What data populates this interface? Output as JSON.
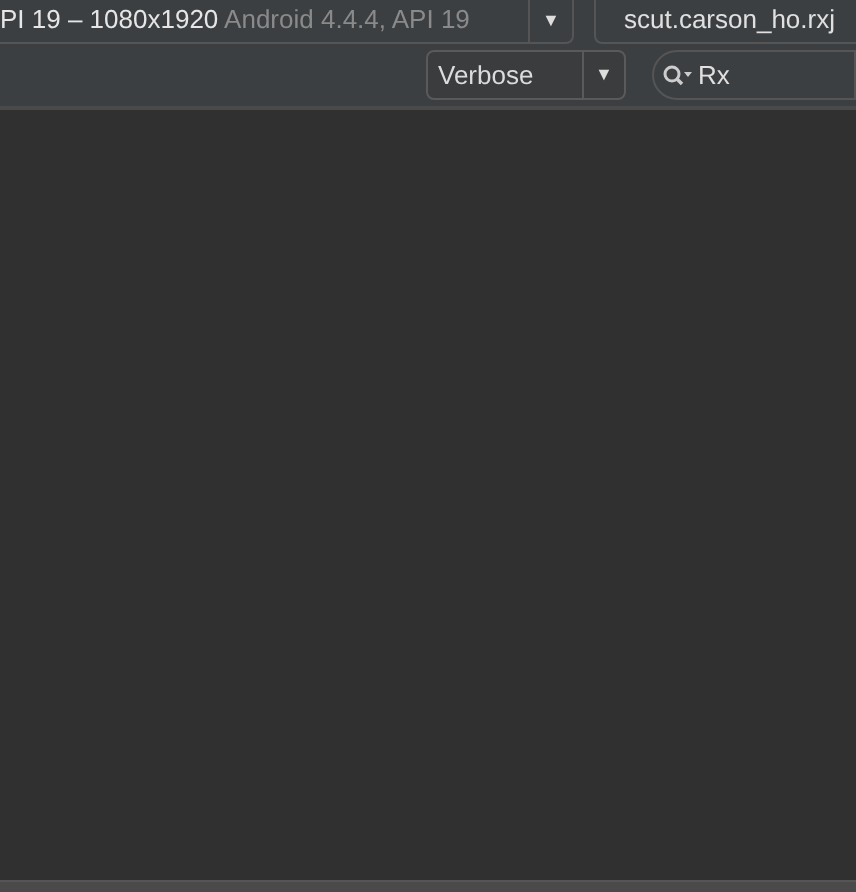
{
  "device_selector": {
    "name": "PI 19 – 1080x1920",
    "detail": "Android 4.4.4, API 19",
    "arrow": "▼"
  },
  "process_selector": {
    "value": "scut.carson_ho.rxj"
  },
  "log_level": {
    "value": "Verbose",
    "arrow": "▼"
  },
  "search": {
    "value": "Rx"
  }
}
